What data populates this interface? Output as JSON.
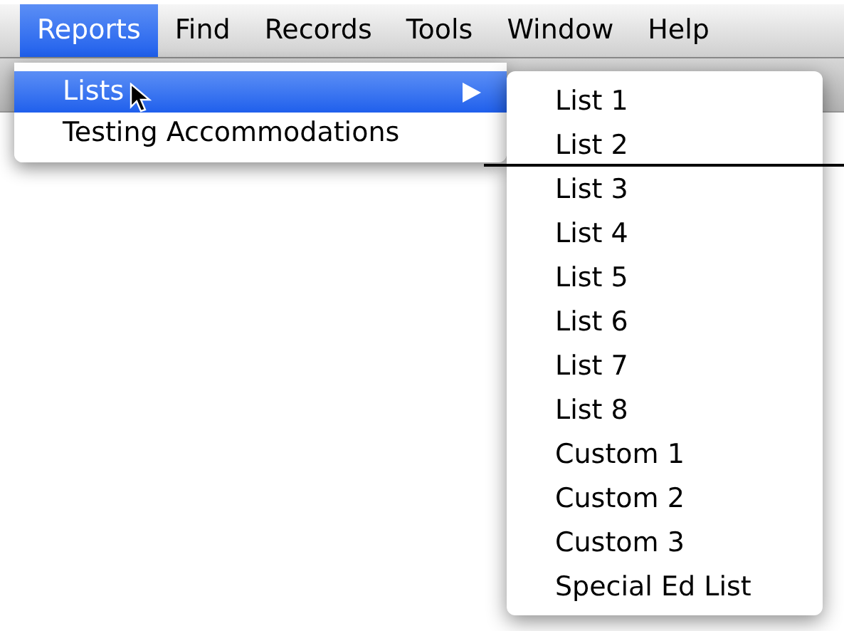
{
  "menu_bar": [
    {
      "label": "Reports",
      "selected": true
    },
    {
      "label": "Find",
      "selected": false
    },
    {
      "label": "Records",
      "selected": false
    },
    {
      "label": "Tools",
      "selected": false
    },
    {
      "label": "Window",
      "selected": false
    },
    {
      "label": "Help",
      "selected": false
    }
  ],
  "reports_menu": {
    "items": [
      {
        "label": "Lists",
        "selected": true,
        "has_submenu": true
      },
      {
        "label": "Testing Accommodations",
        "selected": false,
        "has_submenu": false
      }
    ]
  },
  "lists_submenu": {
    "items": [
      {
        "label": "List 1"
      },
      {
        "label": "List 2"
      },
      {
        "label": "List 3"
      },
      {
        "label": "List 4"
      },
      {
        "label": "List 5"
      },
      {
        "label": "List 6"
      },
      {
        "label": "List 7"
      },
      {
        "label": "List 8"
      },
      {
        "label": "Custom 1"
      },
      {
        "label": "Custom 2"
      },
      {
        "label": "Custom 3"
      },
      {
        "label": "Special Ed List"
      }
    ]
  }
}
